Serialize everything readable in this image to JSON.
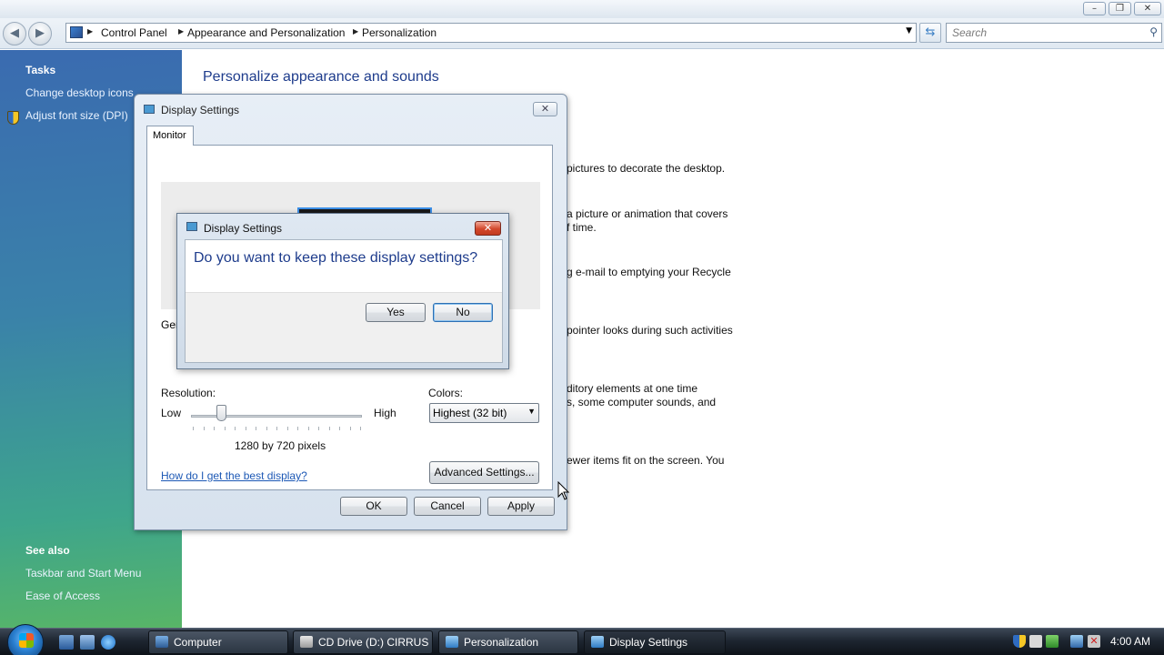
{
  "address": {
    "crumbs": [
      "Control Panel",
      "Appearance and Personalization",
      "Personalization"
    ],
    "search_placeholder": "Search"
  },
  "taskpane": {
    "tasks_heading": "Tasks",
    "tasks": [
      "Change desktop icons",
      "Adjust font size (DPI)"
    ],
    "see_also_heading": "See also",
    "see_also": [
      "Taskbar and Start Menu",
      "Ease of Access"
    ]
  },
  "main": {
    "title": "Personalize appearance and sounds",
    "desc_fragments": [
      "pictures to decorate the desktop.",
      "a picture or animation that covers",
      "f time.",
      "g e-mail to emptying your Recycle",
      "pointer looks during such activities",
      "ditory elements at one time",
      "s, some computer sounds, and",
      "ewer items fit on the screen. You"
    ]
  },
  "display_settings": {
    "title": "Display Settings",
    "tab": "Monitor",
    "general_cut": "Ger",
    "resolution_label": "Resolution:",
    "low": "Low",
    "high": "High",
    "resolution_value": "1280 by 720 pixels",
    "slider_position": 0.18,
    "colors_label": "Colors:",
    "colors_value": "Highest (32 bit)",
    "help_link": "How do I get the best display?",
    "advanced_button": "Advanced Settings...",
    "ok": "OK",
    "cancel": "Cancel",
    "apply": "Apply"
  },
  "confirm": {
    "title": "Display Settings",
    "question": "Do you want to keep these display settings?",
    "yes": "Yes",
    "no": "No"
  },
  "taskbar": {
    "items": [
      "Computer",
      "CD Drive (D:) CIRRUS",
      "Personalization",
      "Display Settings"
    ],
    "clock": "4:00 AM"
  }
}
